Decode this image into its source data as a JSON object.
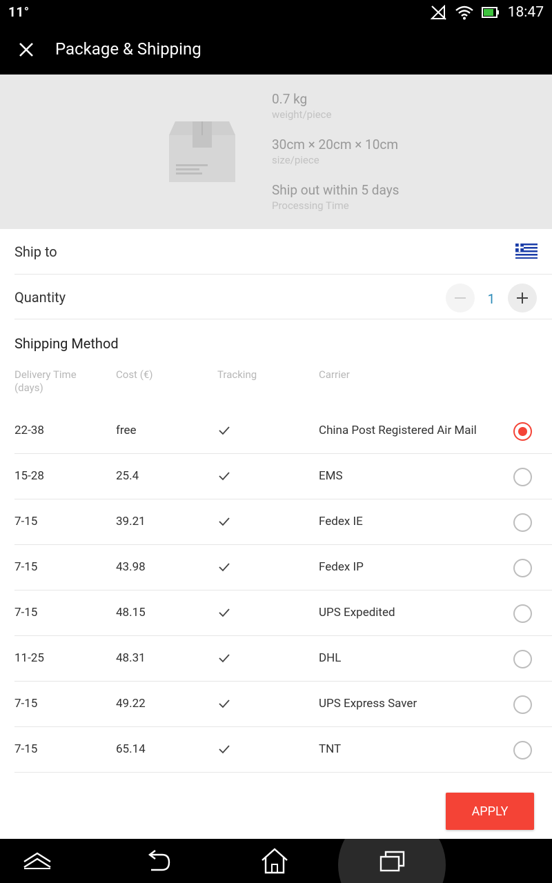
{
  "status_bar": {
    "temperature": "11°",
    "time": "18:47"
  },
  "header": {
    "title": "Package & Shipping"
  },
  "package": {
    "weight_value": "0.7 kg",
    "weight_label": "weight/piece",
    "size_value": "30cm × 20cm × 10cm",
    "size_label": "size/piece",
    "processing_value": "Ship out within 5 days",
    "processing_label": "Processing Time"
  },
  "ship_to": {
    "label": "Ship to",
    "flag_icon": "greece-flag-icon"
  },
  "quantity": {
    "label": "Quantity",
    "value": "1"
  },
  "shipping": {
    "title": "Shipping Method",
    "columns": {
      "delivery_time": "Delivery Time",
      "delivery_time_unit": "(days)",
      "cost": "Cost (€)",
      "tracking": "Tracking",
      "carrier": "Carrier"
    },
    "methods": [
      {
        "time": "22-38",
        "cost": "free",
        "tracking": true,
        "carrier": "China Post Registered Air Mail",
        "selected": true
      },
      {
        "time": "15-28",
        "cost": "25.4",
        "tracking": true,
        "carrier": "EMS",
        "selected": false
      },
      {
        "time": "7-15",
        "cost": "39.21",
        "tracking": true,
        "carrier": "Fedex IE",
        "selected": false
      },
      {
        "time": "7-15",
        "cost": "43.98",
        "tracking": true,
        "carrier": "Fedex IP",
        "selected": false
      },
      {
        "time": "7-15",
        "cost": "48.15",
        "tracking": true,
        "carrier": "UPS Expedited",
        "selected": false
      },
      {
        "time": "11-25",
        "cost": "48.31",
        "tracking": true,
        "carrier": "DHL",
        "selected": false
      },
      {
        "time": "7-15",
        "cost": "49.22",
        "tracking": true,
        "carrier": "UPS Express Saver",
        "selected": false
      },
      {
        "time": "7-15",
        "cost": "65.14",
        "tracking": true,
        "carrier": "TNT",
        "selected": false
      }
    ]
  },
  "apply_label": "APPLY",
  "colors": {
    "accent": "#f44336",
    "quantity_text": "#2a8ab8"
  }
}
